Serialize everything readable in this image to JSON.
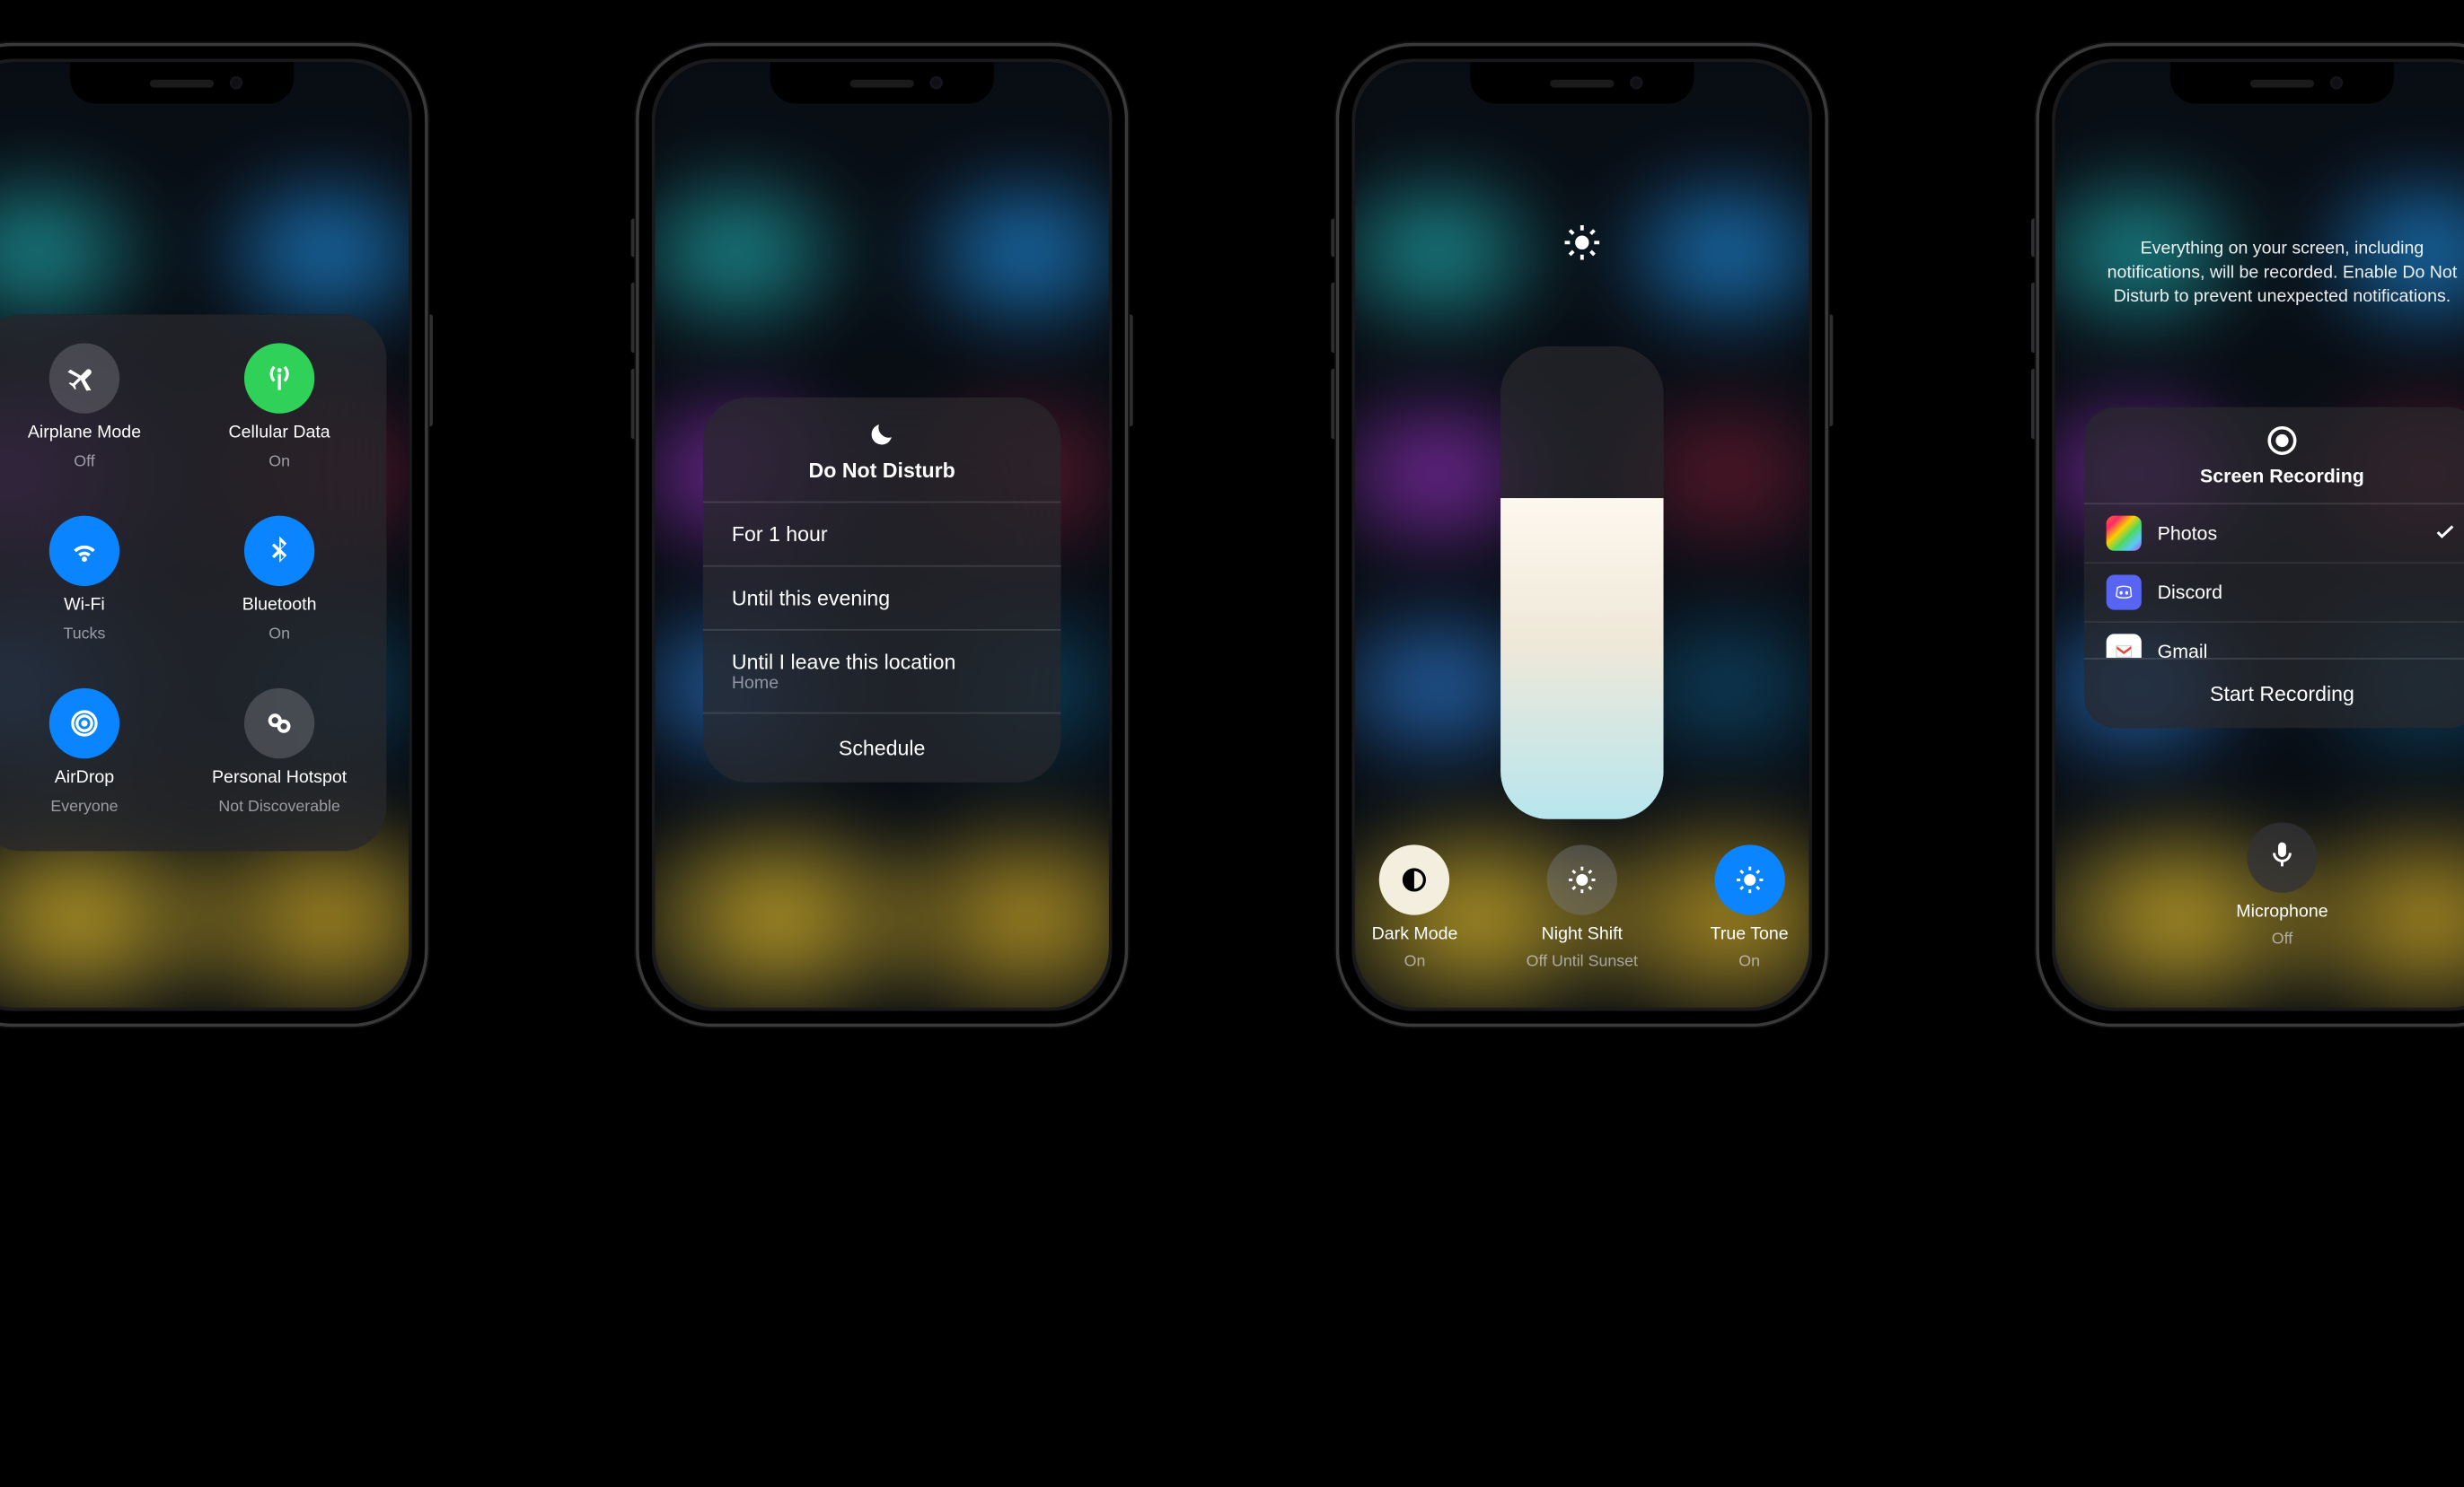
{
  "phone1": {
    "items": [
      {
        "title": "Airplane Mode",
        "sub": "Off"
      },
      {
        "title": "Cellular Data",
        "sub": "On"
      },
      {
        "title": "Wi-Fi",
        "sub": "Tucks"
      },
      {
        "title": "Bluetooth",
        "sub": "On"
      },
      {
        "title": "AirDrop",
        "sub": "Everyone"
      },
      {
        "title": "Personal Hotspot",
        "sub": "Not Discoverable"
      }
    ]
  },
  "phone2": {
    "title": "Do Not Disturb",
    "rows": [
      {
        "label": "For 1 hour"
      },
      {
        "label": "Until this evening"
      },
      {
        "label": "Until I leave this location",
        "sub": "Home"
      }
    ],
    "schedule": "Schedule"
  },
  "phone3": {
    "brightness_pct": 68,
    "items": [
      {
        "title": "Dark Mode",
        "sub": "On"
      },
      {
        "title": "Night Shift",
        "sub": "Off Until Sunset"
      },
      {
        "title": "True Tone",
        "sub": "On"
      }
    ]
  },
  "phone4": {
    "message": "Everything on your screen, including notifications, will be recorded. Enable Do Not Disturb to prevent unexpected notifications.",
    "title": "Screen Recording",
    "apps": [
      {
        "name": "Photos",
        "selected": true
      },
      {
        "name": "Discord",
        "selected": false
      },
      {
        "name": "Gmail",
        "selected": false
      }
    ],
    "start": "Start Recording",
    "mic_title": "Microphone",
    "mic_sub": "Off"
  }
}
